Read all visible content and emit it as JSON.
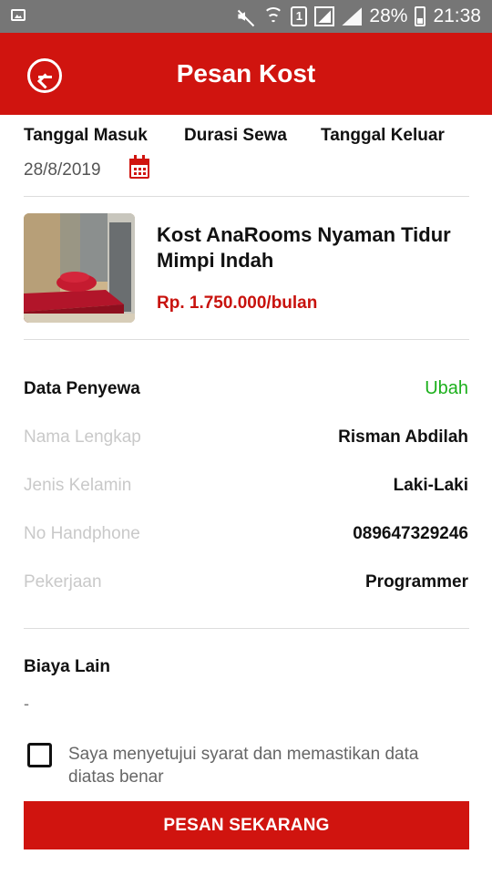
{
  "status_bar": {
    "battery": "28%",
    "time": "21:38",
    "sim_label": "1"
  },
  "app_bar": {
    "title": "Pesan Kost",
    "back_icon": "back-arrow-circle-icon"
  },
  "dates": {
    "check_in_label": "Tanggal Masuk",
    "duration_label": "Durasi Sewa",
    "check_out_label": "Tanggal Keluar",
    "check_in_value": "28/8/2019",
    "calendar_icon": "calendar-icon"
  },
  "kost": {
    "name": "Kost AnaRooms Nyaman Tidur Mimpi Indah",
    "price": "Rp. 1.750.000/bulan"
  },
  "tenant": {
    "section_title": "Data Penyewa",
    "edit_label": "Ubah",
    "rows": [
      {
        "label": "Nama Lengkap",
        "value": "Risman Abdilah"
      },
      {
        "label": "Jenis Kelamin",
        "value": "Laki-Laki"
      },
      {
        "label": "No Handphone",
        "value": "089647329246"
      },
      {
        "label": "Pekerjaan",
        "value": "Programmer"
      }
    ]
  },
  "other_costs": {
    "section_title": "Biaya Lain",
    "value": "-"
  },
  "agreement": {
    "text": "Saya menyetujui syarat dan memastikan data diatas benar",
    "checked": false
  },
  "actions": {
    "submit_label": "PESAN SEKARANG"
  },
  "colors": {
    "primary": "#d0140f",
    "accent_green": "#1cb01c"
  }
}
